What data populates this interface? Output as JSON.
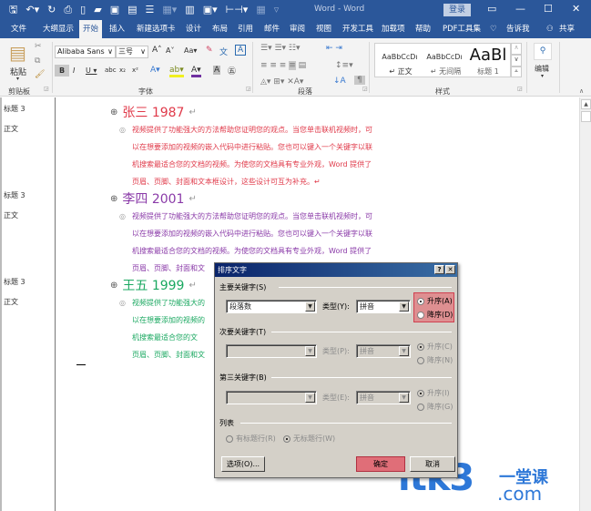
{
  "titlebar": {
    "title": "Word - Word",
    "login_label": "登录",
    "qat_icons": [
      "save-icon",
      "undo-icon",
      "redo-icon",
      "print-preview-icon",
      "new-doc-icon",
      "open-folder-icon",
      "paste-icon",
      "paste-special-icon",
      "document-icon",
      "table-icon",
      "columns-icon",
      "clipboard-icon",
      "spacing-icon",
      "disabled-icon"
    ],
    "window_buttons": {
      "ribbon_options": "▭",
      "minimize": "—",
      "maximize": "☐",
      "close": "✕"
    }
  },
  "tabs": [
    {
      "label": "文件"
    },
    {
      "label": "大纲显示"
    },
    {
      "label": "开始",
      "active": true
    },
    {
      "label": "插入"
    },
    {
      "label": "新建选项卡"
    },
    {
      "label": "设计"
    },
    {
      "label": "布局"
    },
    {
      "label": "引用"
    },
    {
      "label": "邮件"
    },
    {
      "label": "审阅"
    },
    {
      "label": "视图"
    },
    {
      "label": "开发工具"
    },
    {
      "label": "加载项"
    },
    {
      "label": "帮助"
    },
    {
      "label": "PDF工具集"
    },
    {
      "label": "告诉我"
    },
    {
      "label": "共享"
    }
  ],
  "ribbon": {
    "clipboard": {
      "paste_label": "粘贴",
      "group_label": "剪贴板"
    },
    "font": {
      "font_name": "Alibaba Sans",
      "font_size": "三号",
      "group_label": "字体"
    },
    "paragraph": {
      "group_label": "段落"
    },
    "styles": {
      "group_label": "样式",
      "items": [
        {
          "preview": "AaBbCcDı",
          "name": "正文"
        },
        {
          "preview": "AaBbCcDı",
          "name": "无间隔"
        },
        {
          "preview": "AaBl",
          "name": "标题 1"
        }
      ]
    },
    "editing": {
      "label": "编辑"
    }
  },
  "nav": {
    "labels": [
      "标题 3",
      "正文",
      "标题 3",
      "正文",
      "标题 3",
      "正文"
    ]
  },
  "document": {
    "sections": [
      {
        "heading": "张三 1987",
        "color": "#e03a4a",
        "body": "视频提供了功能强大的方法帮助您证明您的观点。当您单击联机视频时，可以在想要添加的视频的嵌入代码中进行粘贴。您也可以键入一个关键字以联机搜索最适合您的文档的视频。为使您的文档具有专业外观，Word 提供了页眉、页脚、封面和文本框设计，这些设计可互为补充。"
      },
      {
        "heading": "李四 2001",
        "color": "#8a3aa8",
        "body": "视频提供了功能强大的方法帮助您证明您的观点。当您单击联机视频时，可以在想要添加的视频的嵌入代码中进行粘贴。您也可以键入一个关键字以联机搜索最适合您的文档的视频。为使您的文档具有专业外观，Word 提供了页眉、页脚、封面和文"
      },
      {
        "heading": "王五 1999",
        "color": "#1aa860",
        "body": "视频提供了功能强大的以在想要添加的视频的机搜索最适合您的文页眉、页脚、封面和文"
      }
    ],
    "lines": {
      "s1": [
        "视频提供了功能强大的方法帮助您证明您的观点。当您单击联机视频时，可",
        "以在想要添加的视频的嵌入代码中进行粘贴。您也可以键入一个关键字以联",
        "机搜索最适合您的文档的视频。为使您的文档具有专业外观，Word 提供了",
        "页眉、页脚、封面和文本框设计，这些设计可互为补充。↵"
      ],
      "s2": [
        "视频提供了功能强大的方法帮助您证明您的观点。当您单击联机视频时，可",
        "以在想要添加的视频的嵌入代码中进行粘贴。您也可以键入一个关键字以联",
        "机搜索最适合您的文档的视频。为使您的文档具有专业外观，Word 提供了",
        "页眉、页脚、封面和文"
      ],
      "s3": [
        "视频提供了功能强大的",
        "以在想要添加的视频的",
        "机搜索最适合您的文",
        "页眉、页脚、封面和文"
      ]
    }
  },
  "dialog": {
    "title": "排序文字",
    "help": "?",
    "close": "✕",
    "primary": {
      "section": "主要关键字(S)",
      "field": "段落数",
      "type_label": "类型(Y):",
      "type_value": "拼音",
      "asc": "升序(A)",
      "desc": "降序(D)",
      "selected": "asc"
    },
    "secondary": {
      "section": "次要关键字(T)",
      "field": "",
      "type_label": "类型(P):",
      "type_value": "拼音",
      "asc": "升序(C)",
      "desc": "降序(N)",
      "selected": "asc"
    },
    "tertiary": {
      "section": "第三关键字(B)",
      "field": "",
      "type_label": "类型(E):",
      "type_value": "拼音",
      "asc": "升序(I)",
      "desc": "降序(G)",
      "selected": "asc"
    },
    "list": {
      "section": "列表",
      "has_header": "有标题行(R)",
      "no_header": "无标题行(W)",
      "selected": "no_header"
    },
    "options_button": "选项(O)...",
    "ok_button": "确定",
    "cancel_button": "取消",
    "highlight_color": "#e06e78"
  },
  "watermark": {
    "main": "itk3",
    "sub1": "一堂课",
    "sub2": ".com",
    "color": "#2e78d8"
  }
}
